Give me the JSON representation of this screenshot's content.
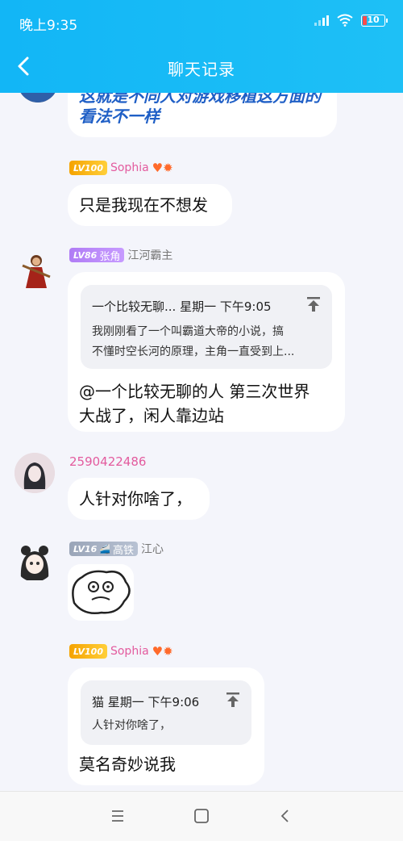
{
  "status": {
    "time": "晚上9:35",
    "battery": "10"
  },
  "header": {
    "title": "聊天记录"
  },
  "messages": [
    {
      "text": "这就是不同人对游戏移植这方面的看法不一样"
    },
    {
      "level": "LV100",
      "name": "Sophia",
      "text": "只是我现在不想发"
    },
    {
      "level": "LV86",
      "title": "张角",
      "name": "江河霸主",
      "quote": {
        "head": "一个比较无聊... 星期一 下午9:05",
        "body1": "我刚刚看了一个叫霸道大帝的小说，搞",
        "body2": "不懂时空长河的原理，主角一直受到上..."
      },
      "text1": "@一个比较无聊的人 第三次世界",
      "text2": "大战了，闲人靠边站"
    },
    {
      "name": "2590422486",
      "text": "人针对你啥了，"
    },
    {
      "level": "LV16",
      "title": "高铁",
      "name": "江心"
    },
    {
      "level": "LV100",
      "name": "Sophia",
      "quote": {
        "head": "猫 星期一 下午9:06",
        "body1": "人针对你啥了，"
      },
      "text": "莫名奇妙说我"
    }
  ]
}
